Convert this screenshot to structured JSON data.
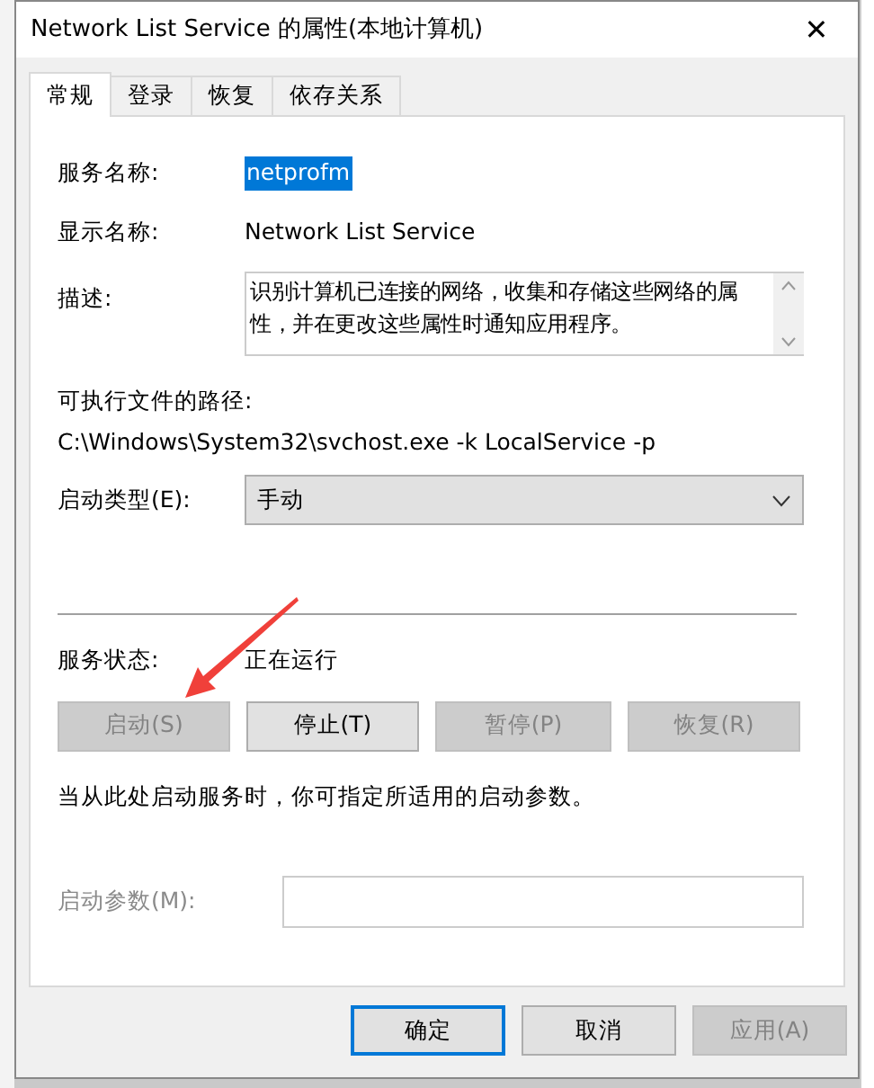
{
  "window": {
    "title": "Network List Service 的属性(本地计算机)",
    "close": "✕"
  },
  "tabs": [
    {
      "label": "常规",
      "selected": true
    },
    {
      "label": "登录",
      "selected": false
    },
    {
      "label": "恢复",
      "selected": false
    },
    {
      "label": "依存关系",
      "selected": false
    }
  ],
  "service_name": {
    "label": "服务名称:",
    "value": "netprofm",
    "selected": true
  },
  "display_name": {
    "label": "显示名称:",
    "value": "Network List Service"
  },
  "description": {
    "label": "描述:",
    "value": "识别计算机已连接的网络，收集和存储这些网络的属性，并在更改这些属性时通知应用程序。"
  },
  "executable_path": {
    "label": "可执行文件的路径:",
    "value": "C:\\Windows\\System32\\svchost.exe -k LocalService -p"
  },
  "startup_type": {
    "label": "启动类型(E):",
    "value": "手动"
  },
  "service_status": {
    "label": "服务状态:",
    "value": "正在运行"
  },
  "service_buttons": [
    {
      "label": "启动(S)",
      "disabled": true
    },
    {
      "label": "停止(T)",
      "disabled": false
    },
    {
      "label": "暂停(P)",
      "disabled": true
    },
    {
      "label": "恢复(R)",
      "disabled": true
    }
  ],
  "hint": "当从此处启动服务时，你可指定所适用的启动参数。",
  "start_parameters": {
    "label": "启动参数(M):",
    "disabled": true
  },
  "dialog_buttons": [
    {
      "label": "确定",
      "default": true,
      "disabled": false
    },
    {
      "label": "取消",
      "default": false,
      "disabled": false
    },
    {
      "label": "应用(A)",
      "default": false,
      "disabled": true
    }
  ]
}
